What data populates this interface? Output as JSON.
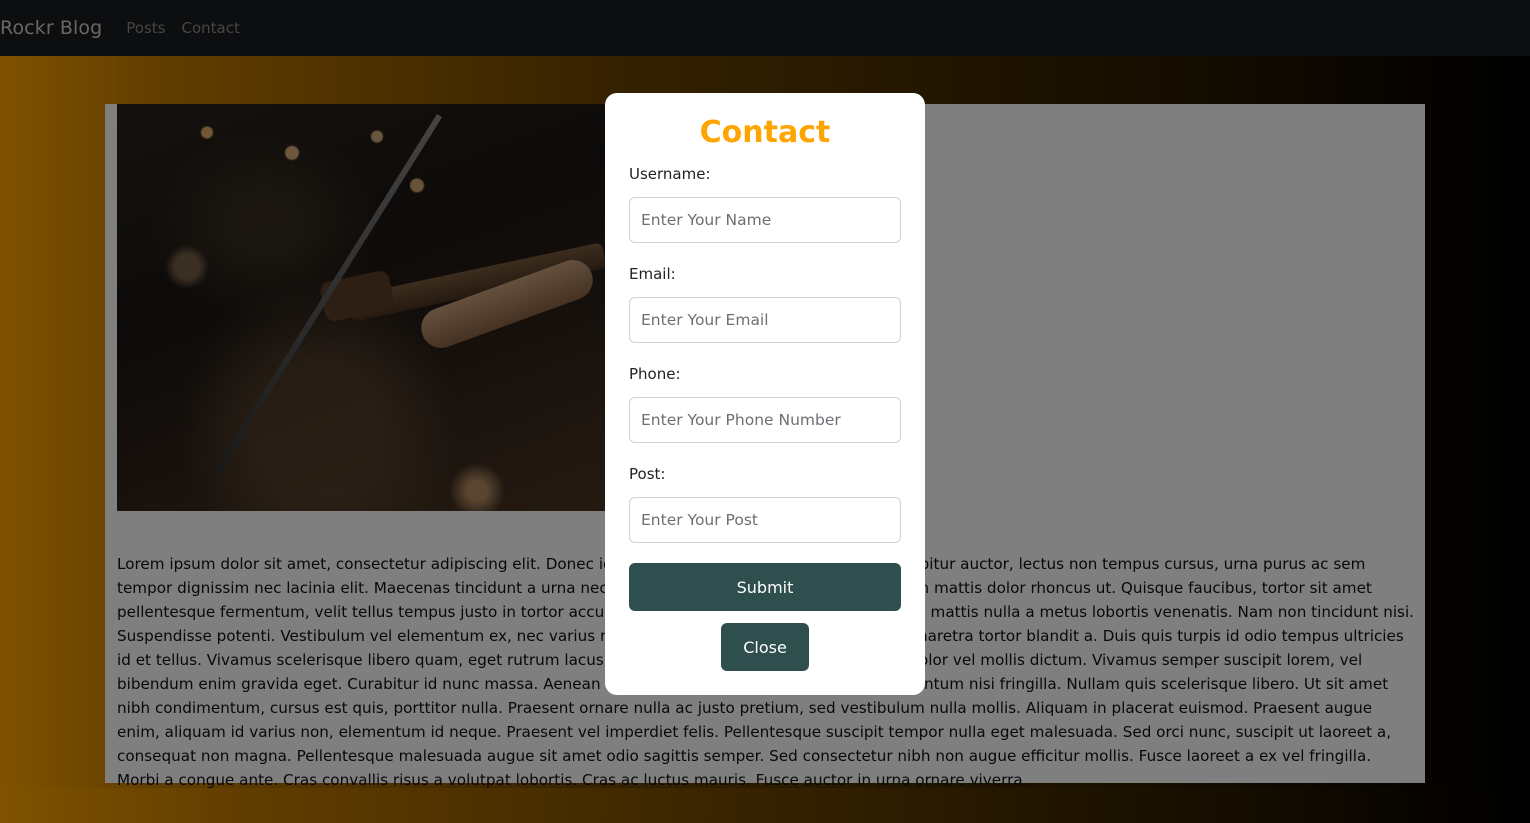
{
  "navbar": {
    "brand": "Rockr Blog",
    "links": [
      "Posts",
      "Contact"
    ]
  },
  "content": {
    "image_alt": "concert-guitarist-photo",
    "body": "Lorem ipsum dolor sit amet, consectetur adipiscing elit. Donec id odio nec lorem fermentum lacinia. Curabitur auctor, lectus non tempus cursus, urna purus ac sem tempor dignissim nec lacinia elit. Maecenas tincidunt a urna nec cursus. Mauris viverra facilisis lectus, non mattis dolor rhoncus ut. Quisque faucibus, tortor sit amet pellentesque fermentum, velit tellus tempus justo in tortor accumsan, sit amet ultricies nulla dictum. Cras mattis nulla a metus lobortis venenatis. Nam non tincidunt nisi. Suspendisse potenti. Vestibulum vel elementum ex, nec varius risus. Integer iaculis dignissim orci, quis pharetra tortor blandit a. Duis quis turpis id odio tempus ultricies id et tellus. Vivamus scelerisque libero quam, eget rutrum lacus pellentesque vel. Sed interdum nibh at dolor vel mollis dictum. Vivamus semper suscipit lorem, vel bibendum enim gravida eget. Curabitur id nunc massa. Aenean rutrum ipsum ut massa tincidunt, a fermentum nisi fringilla. Nullam quis scelerisque libero. Ut sit amet nibh condimentum, cursus est quis, porttitor nulla. Praesent ornare nulla ac justo pretium, sed vestibulum nulla mollis. Aliquam in placerat euismod. Praesent augue enim, aliquam id varius non, elementum id neque. Praesent vel imperdiet felis. Pellentesque suscipit tempor nulla eget malesuada. Sed orci nunc, suscipit ut laoreet a, consequat non magna. Pellentesque malesuada augue sit amet odio sagittis semper. Sed consectetur nibh non augue efficitur mollis. Fusce laoreet a ex vel fringilla. Morbi a congue ante. Cras convallis risus a volutpat lobortis. Cras ac luctus mauris. Fusce auctor in urna ornare viverra."
  },
  "modal": {
    "title": "Contact",
    "fields": [
      {
        "label": "Username:",
        "placeholder": "Enter Your Name"
      },
      {
        "label": "Email:",
        "placeholder": "Enter Your Email"
      },
      {
        "label": "Phone:",
        "placeholder": "Enter Your Phone Number"
      },
      {
        "label": "Post:",
        "placeholder": "Enter Your Post"
      }
    ],
    "submit_label": "Submit",
    "close_label": "Close"
  },
  "colors": {
    "accent": "#ffa500",
    "button": "#2f4f4f",
    "navbar": "#1a1d21"
  }
}
